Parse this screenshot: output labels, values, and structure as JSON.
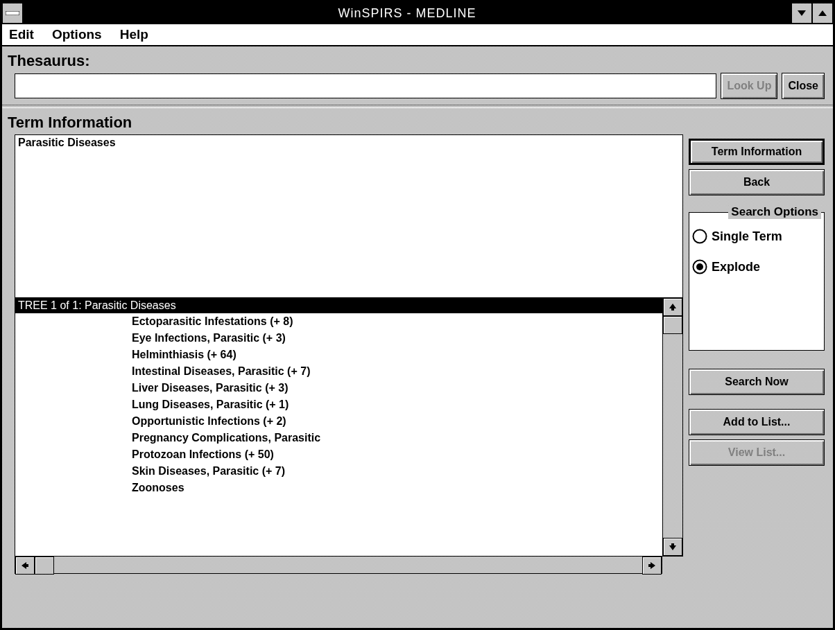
{
  "window": {
    "title": "WinSPIRS - MEDLINE"
  },
  "menu": [
    {
      "label": "Edit"
    },
    {
      "label": "Options"
    },
    {
      "label": "Help"
    }
  ],
  "thesaurus": {
    "label": "Thesaurus:",
    "buttons": [
      {
        "label": "Look Up",
        "disabled": true
      },
      {
        "label": "Close",
        "disabled": false
      }
    ]
  },
  "term_information": {
    "heading": "Term Information",
    "text": "Parasitic Diseases"
  },
  "tree": {
    "header": "TREE 1 of 1: Parasitic Diseases",
    "header_selected": true,
    "items": [
      {
        "label": "Ectoparasitic Infestations (+ 8)"
      },
      {
        "label": "Eye Infections, Parasitic (+ 3)"
      },
      {
        "label": "Helminthiasis (+ 64)"
      },
      {
        "label": "Intestinal Diseases, Parasitic (+ 7)"
      },
      {
        "label": "Liver Diseases, Parasitic (+ 3)"
      },
      {
        "label": "Lung Diseases, Parasitic (+ 1)"
      },
      {
        "label": "Opportunistic Infections (+ 2)"
      },
      {
        "label": "Pregnancy Complications, Parasitic"
      },
      {
        "label": "Protozoan Infections (+ 50)"
      },
      {
        "label": "Skin Diseases, Parasitic (+ 7)"
      },
      {
        "label": "Zoonoses"
      }
    ]
  },
  "side_buttons": [
    {
      "label": "Term Information",
      "default": true,
      "disabled": false
    },
    {
      "label": "Back",
      "default": false,
      "disabled": false
    }
  ],
  "search_options": {
    "title": "Search Options",
    "options": [
      {
        "label": "Single Term",
        "selected": false
      },
      {
        "label": "Explode",
        "selected": true
      }
    ]
  },
  "action_buttons": [
    {
      "label": "Search Now",
      "disabled": false
    },
    {
      "label": "Add to List...",
      "disabled": false
    },
    {
      "label": "View List...",
      "disabled": true
    }
  ]
}
